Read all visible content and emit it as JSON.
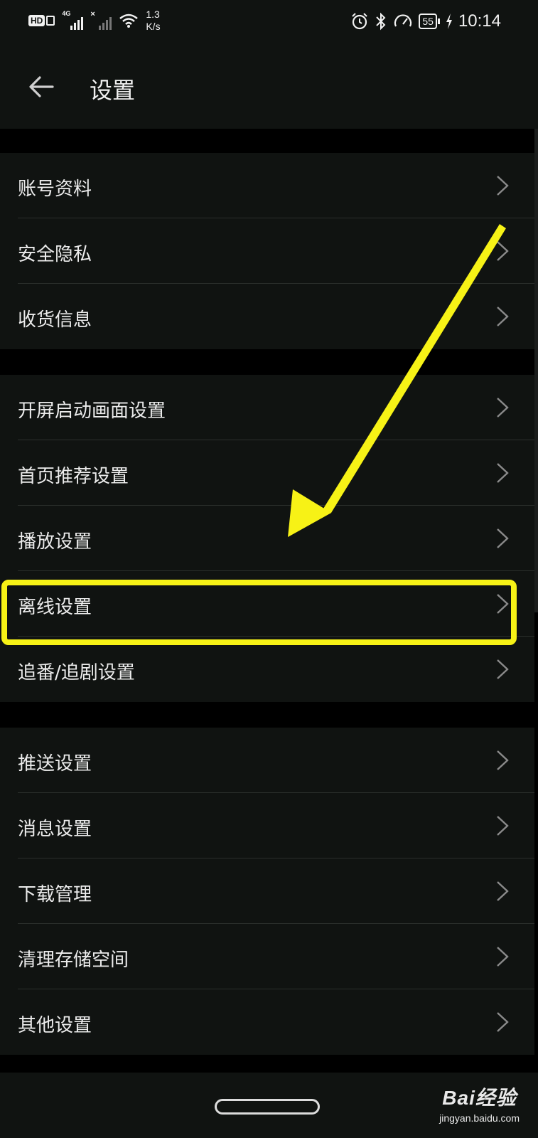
{
  "status_bar": {
    "hd_label": "HD",
    "network_label": "4G",
    "speed_value": "1.3",
    "speed_unit": "K/s",
    "battery": "55",
    "time": "10:14",
    "icons": [
      "alarm-icon",
      "bluetooth-icon",
      "data-saver-icon",
      "battery-icon",
      "charging-icon"
    ]
  },
  "header": {
    "title": "设置",
    "back_icon": "arrow-left-icon"
  },
  "groups": [
    {
      "items": [
        {
          "label": "账号资料"
        },
        {
          "label": "安全隐私"
        },
        {
          "label": "收货信息"
        }
      ]
    },
    {
      "items": [
        {
          "label": "开屏启动画面设置"
        },
        {
          "label": "首页推荐设置"
        },
        {
          "label": "播放设置"
        },
        {
          "label": "离线设置"
        },
        {
          "label": "追番/追剧设置"
        }
      ]
    },
    {
      "items": [
        {
          "label": "推送设置"
        },
        {
          "label": "消息设置"
        },
        {
          "label": "下载管理"
        },
        {
          "label": "清理存储空间"
        },
        {
          "label": "其他设置"
        }
      ]
    }
  ],
  "annotation": {
    "highlighted_item": "离线设置",
    "color": "#f7f216"
  },
  "watermark": {
    "main": "Bai经验",
    "sub": "jingyan.baidu.com"
  },
  "colors": {
    "background": "#000000",
    "surface": "#101311",
    "text": "#ececec",
    "highlight": "#f7f216"
  }
}
